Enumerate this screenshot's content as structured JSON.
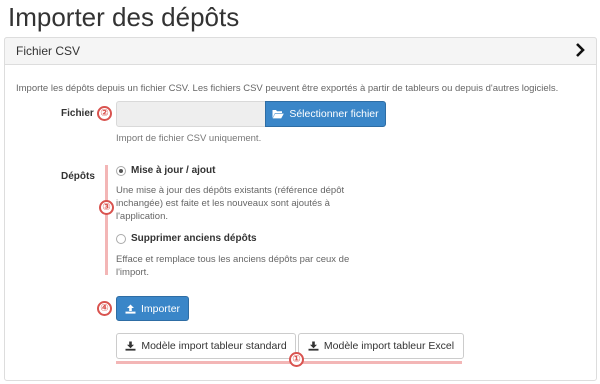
{
  "page": {
    "title": "Importer des dépôts"
  },
  "panel": {
    "title": "Fichier CSV",
    "intro": "Importe les dépôts depuis un fichier CSV. Les fichiers CSV peuvent être exportés à partir de tableurs ou depuis d'autres logiciels."
  },
  "file": {
    "label": "Fichier",
    "value": "",
    "select_label": "Sélectionner fichier",
    "help": "Import de fichier CSV uniquement."
  },
  "depots": {
    "label": "Dépôts",
    "options": [
      {
        "label": "Mise à jour / ajout",
        "checked": true,
        "description": "Une mise à jour des dépôts existants (référence dépôt inchangée) est faite et les nouveaux sont ajoutés à l'application."
      },
      {
        "label": "Supprimer anciens dépôts",
        "checked": false,
        "description": "Efface et remplace tous les anciens dépôts par ceux de l'import."
      }
    ]
  },
  "actions": {
    "import_label": "Importer",
    "template_standard_label": "Modèle import tableur standard",
    "template_excel_label": "Modèle import tableur Excel"
  },
  "annotations": [
    "①",
    "②",
    "③",
    "④"
  ],
  "colors": {
    "primary": "#3a86c8",
    "marker": "#d9534f",
    "marker_light": "#f3b6b6"
  }
}
